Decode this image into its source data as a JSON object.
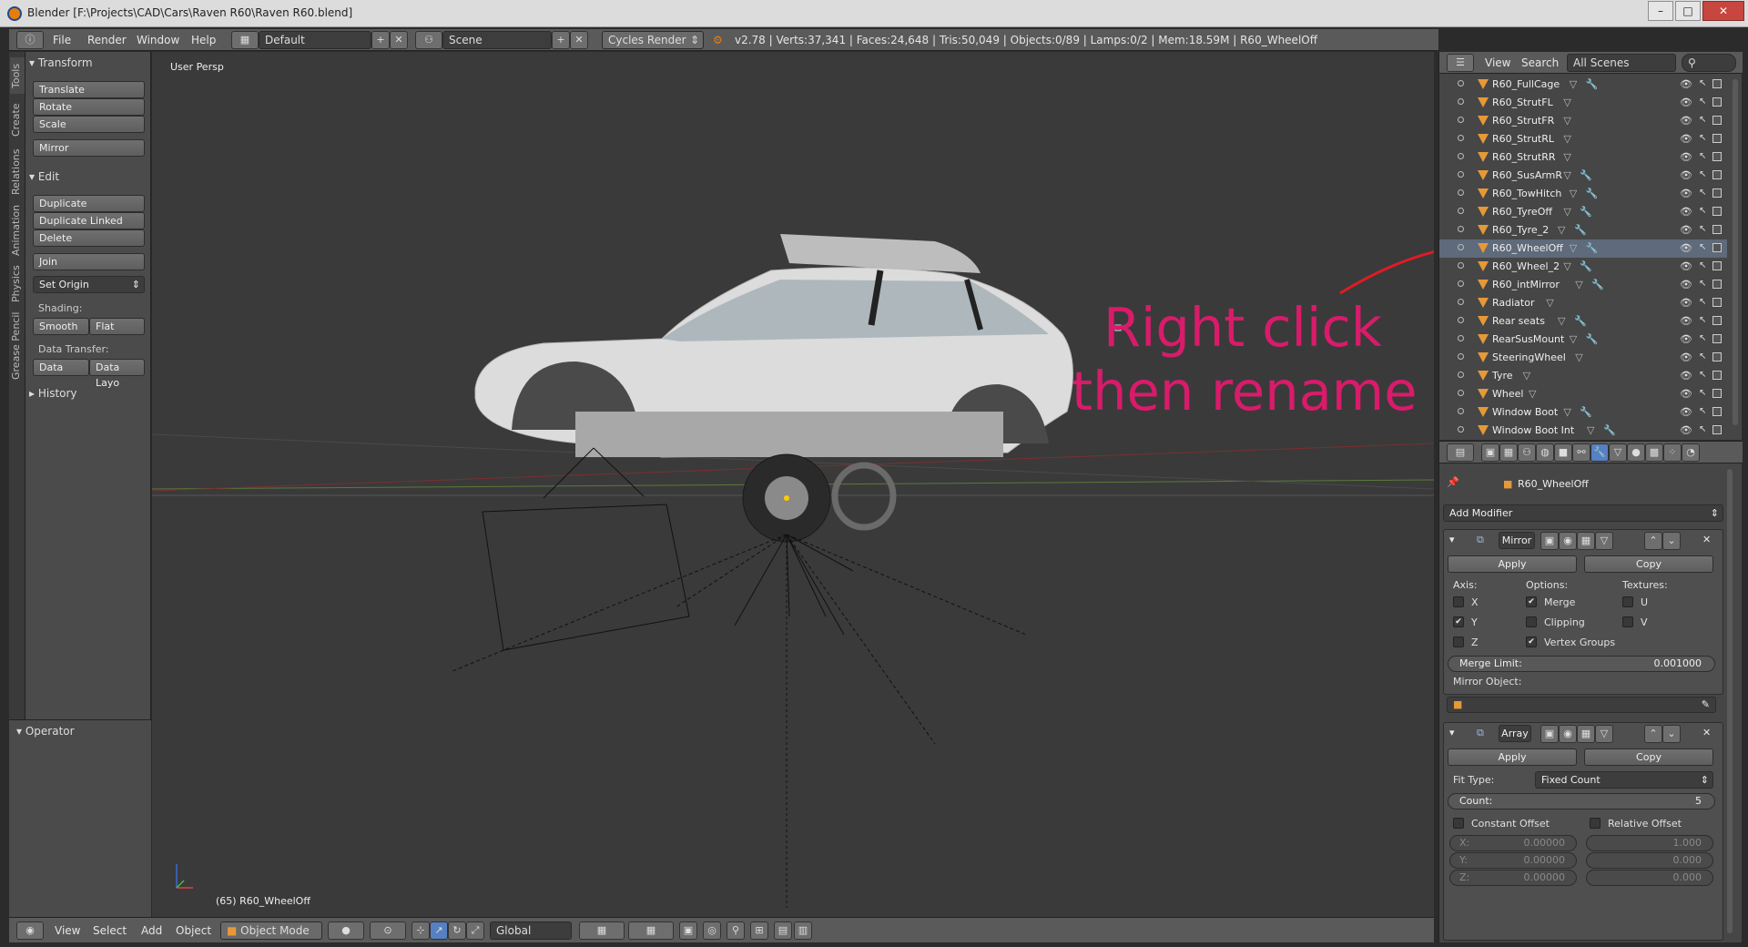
{
  "titlebar": {
    "text": "Blender [F:\\Projects\\CAD\\Cars\\Raven R60\\Raven R60.blend]"
  },
  "menu": {
    "items": [
      "File",
      "Render",
      "Window",
      "Help"
    ]
  },
  "header": {
    "layout": "Default",
    "scene": "Scene",
    "engine": "Cycles Render",
    "stats": "v2.78 | Verts:37,341 | Faces:24,648 | Tris:50,049 | Objects:0/89 | Lamps:0/2 | Mem:18.59M | R60_WheelOff"
  },
  "tabs": [
    "Tools",
    "Create",
    "Relations",
    "Animation",
    "Physics",
    "Grease Pencil"
  ],
  "toolshelf": {
    "transform_header": "Transform",
    "translate": "Translate",
    "rotate": "Rotate",
    "scale": "Scale",
    "mirror": "Mirror",
    "edit_header": "Edit",
    "duplicate": "Duplicate",
    "duplicate_linked": "Duplicate Linked",
    "delete": "Delete",
    "join": "Join",
    "set_origin": "Set Origin",
    "shading_label": "Shading:",
    "smooth": "Smooth",
    "flat": "Flat",
    "data_transfer_label": "Data Transfer:",
    "data": "Data",
    "data_layout": "Data Layo",
    "history_header": "History",
    "operator_header": "Operator"
  },
  "viewport": {
    "label": "User Persp",
    "object_info": "(65) R60_WheelOff",
    "annotation_line1": "Right click",
    "annotation_line2": "then rename",
    "annotation_color": "#d81b6a"
  },
  "viewport_header": {
    "view": "View",
    "select": "Select",
    "add": "Add",
    "object": "Object",
    "mode": "Object Mode",
    "orientation": "Global"
  },
  "outliner": {
    "view": "View",
    "search": "Search",
    "filter": "All Scenes",
    "items": [
      {
        "name": "R60_FullCage",
        "selected": false
      },
      {
        "name": "R60_StrutFL",
        "selected": false
      },
      {
        "name": "R60_StrutFR",
        "selected": false
      },
      {
        "name": "R60_StrutRL",
        "selected": false
      },
      {
        "name": "R60_StrutRR",
        "selected": false
      },
      {
        "name": "R60_SusArmR",
        "selected": false
      },
      {
        "name": "R60_TowHitch",
        "selected": false
      },
      {
        "name": "R60_TyreOff",
        "selected": false
      },
      {
        "name": "R60_Tyre_2",
        "selected": false
      },
      {
        "name": "R60_WheelOff",
        "selected": true
      },
      {
        "name": "R60_Wheel_2",
        "selected": false
      },
      {
        "name": "R60_intMirror",
        "selected": false
      },
      {
        "name": "Radiator",
        "selected": false
      },
      {
        "name": "Rear seats",
        "selected": false
      },
      {
        "name": "RearSusMount",
        "selected": false
      },
      {
        "name": "SteeringWheel",
        "selected": false
      },
      {
        "name": "Tyre",
        "selected": false
      },
      {
        "name": "Wheel",
        "selected": false
      },
      {
        "name": "Window Boot",
        "selected": false
      },
      {
        "name": "Window Boot Int",
        "selected": false
      }
    ]
  },
  "properties": {
    "object_name": "R60_WheelOff",
    "add_modifier": "Add Modifier",
    "mirror": {
      "name": "Mirror",
      "apply": "Apply",
      "copy": "Copy",
      "axis_label": "Axis:",
      "options_label": "Options:",
      "textures_label": "Textures:",
      "axis_x": "X",
      "axis_y": "Y",
      "axis_z": "Z",
      "merge": "Merge",
      "clipping": "Clipping",
      "vertex_groups": "Vertex Groups",
      "tex_u": "U",
      "tex_v": "V",
      "merge_limit_label": "Merge Limit:",
      "merge_limit_value": "0.001000",
      "mirror_object_label": "Mirror Object:"
    },
    "array": {
      "name": "Array",
      "apply": "Apply",
      "copy": "Copy",
      "fit_type_label": "Fit Type:",
      "fit_type_value": "Fixed Count",
      "count_label": "Count:",
      "count_value": "5",
      "constant_offset": "Constant Offset",
      "relative_offset": "Relative Offset",
      "x_label": "X:",
      "y_label": "Y:",
      "z_label": "Z:",
      "const_x": "0.00000",
      "const_y": "0.00000",
      "const_z": "0.00000",
      "rel_x": "1.000",
      "rel_y": "0.000",
      "rel_z": "0.000"
    }
  }
}
